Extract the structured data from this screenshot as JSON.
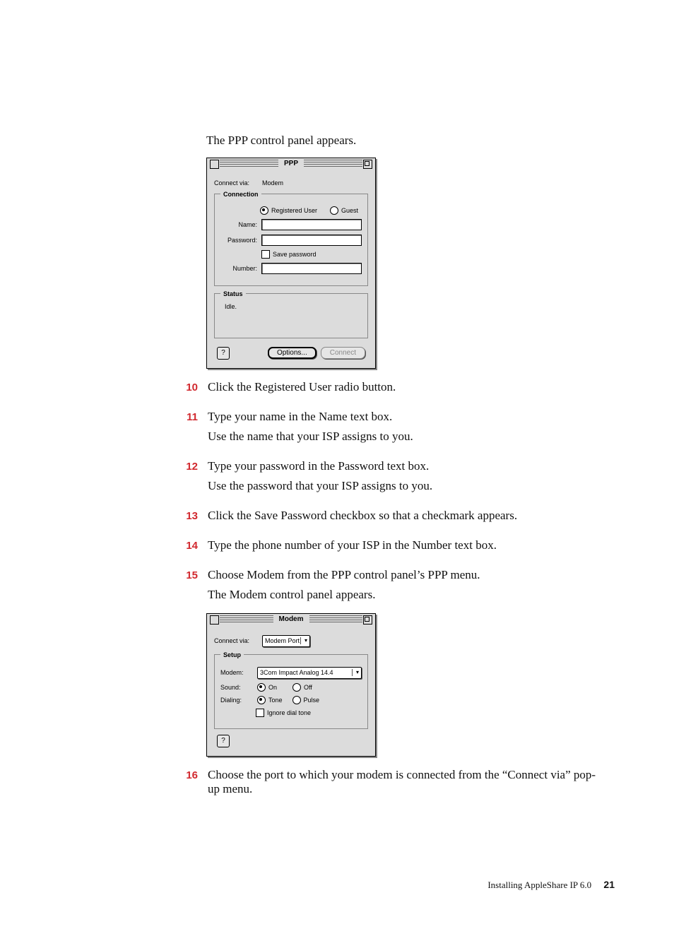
{
  "intro": "The PPP control panel appears.",
  "ppp_window": {
    "title": "PPP",
    "connect_via_label": "Connect via:",
    "connect_via_value": "Modem",
    "connection_legend": "Connection",
    "user_type": {
      "registered": "Registered User",
      "guest": "Guest"
    },
    "name_label": "Name:",
    "name_value": "",
    "password_label": "Password:",
    "password_value": "",
    "save_password_label": "Save password",
    "number_label": "Number:",
    "number_value": "",
    "status_legend": "Status",
    "status_value": "Idle.",
    "options_btn": "Options...",
    "connect_btn": "Connect",
    "help_btn": "?"
  },
  "steps": [
    {
      "n": "10",
      "main": "Click the Registered User radio button."
    },
    {
      "n": "11",
      "main": "Type your name in the Name text box.",
      "sub": "Use the name that your ISP assigns to you."
    },
    {
      "n": "12",
      "main": "Type your password in the Password text box.",
      "sub": "Use the password that your ISP assigns to you."
    },
    {
      "n": "13",
      "main": "Click the Save Password checkbox so that a checkmark appears."
    },
    {
      "n": "14",
      "main": "Type the phone number of your ISP in the Number text box."
    },
    {
      "n": "15",
      "main": "Choose Modem from the PPP control panel’s PPP menu.",
      "sub": "The Modem control panel appears."
    }
  ],
  "modem_window": {
    "title": "Modem",
    "connect_via_label": "Connect via:",
    "connect_via_value": "Modem Port",
    "setup_legend": "Setup",
    "modem_label": "Modem:",
    "modem_value": "3Com Impact Analog 14.4",
    "sound_label": "Sound:",
    "sound_on": "On",
    "sound_off": "Off",
    "dialing_label": "Dialing:",
    "dialing_tone": "Tone",
    "dialing_pulse": "Pulse",
    "ignore_dialtone_label": "Ignore dial tone",
    "help_btn": "?"
  },
  "step16": {
    "n": "16",
    "main": "Choose the port to which your modem is connected from the “Connect via” pop-up menu."
  },
  "footer": {
    "text": "Installing AppleShare IP 6.0",
    "page": "21"
  }
}
